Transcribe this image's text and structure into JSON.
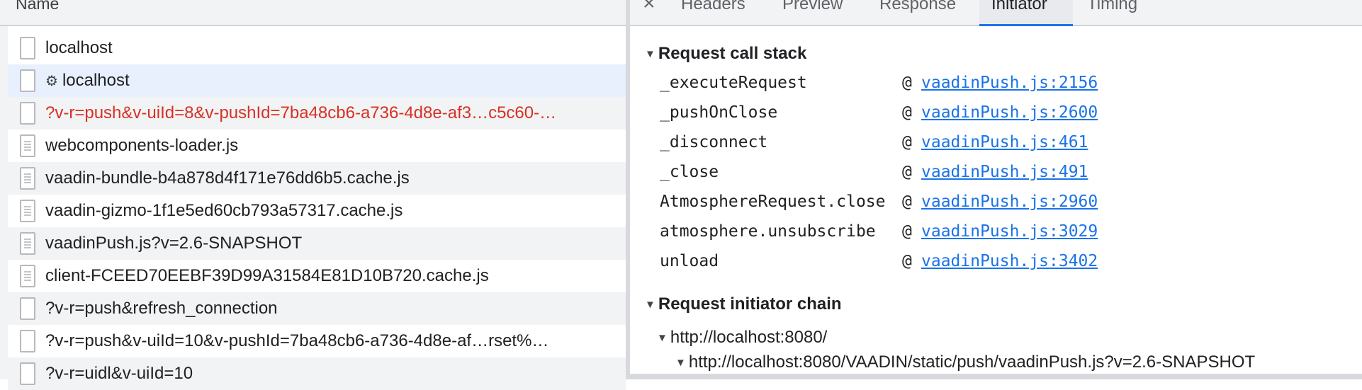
{
  "list": {
    "column_name": "Name",
    "rows": [
      {
        "name": "localhost",
        "icon": "document-icon",
        "gear": ""
      },
      {
        "name": "localhost",
        "icon": "document-icon",
        "gear": "⚙"
      },
      {
        "name": "?v-r=push&v-uiId=8&v-pushId=7ba48cb6-a736-4d8e-af3…c5c60-…",
        "icon": "document-icon",
        "gear": ""
      },
      {
        "name": "webcomponents-loader.js",
        "icon": "script-icon",
        "gear": ""
      },
      {
        "name": "vaadin-bundle-b4a878d4f171e76dd6b5.cache.js",
        "icon": "script-icon",
        "gear": ""
      },
      {
        "name": "vaadin-gizmo-1f1e5ed60cb793a57317.cache.js",
        "icon": "script-icon",
        "gear": ""
      },
      {
        "name": "vaadinPush.js?v=2.6-SNAPSHOT",
        "icon": "script-icon",
        "gear": ""
      },
      {
        "name": "client-FCEED70EEBF39D99A31584E81D10B720.cache.js",
        "icon": "script-icon",
        "gear": ""
      },
      {
        "name": "?v-r=push&refresh_connection",
        "icon": "document-icon",
        "gear": ""
      },
      {
        "name": "?v-r=push&v-uiId=10&v-pushId=7ba48cb6-a736-4d8e-af…rset%…",
        "icon": "document-icon",
        "gear": ""
      },
      {
        "name": "?v-r=uidl&v-uiId=10",
        "icon": "document-icon",
        "gear": ""
      }
    ]
  },
  "tabs": {
    "close": "×",
    "items": [
      "Headers",
      "Preview",
      "Response",
      "Initiator",
      "Timing"
    ],
    "active": "Initiator"
  },
  "call_stack": {
    "toggle": "▼",
    "title": "Request call stack",
    "at": "@",
    "frames": [
      {
        "fn": "_executeRequest",
        "loc": "vaadinPush.js:2156"
      },
      {
        "fn": "_pushOnClose",
        "loc": "vaadinPush.js:2600"
      },
      {
        "fn": "_disconnect",
        "loc": "vaadinPush.js:461"
      },
      {
        "fn": "_close",
        "loc": "vaadinPush.js:491"
      },
      {
        "fn": "AtmosphereRequest.close",
        "loc": "vaadinPush.js:2960"
      },
      {
        "fn": "atmosphere.unsubscribe",
        "loc": "vaadinPush.js:3029"
      },
      {
        "fn": "unload",
        "loc": "vaadinPush.js:3402"
      }
    ]
  },
  "initiator_chain": {
    "toggle": "▼",
    "title": "Request initiator chain",
    "items": [
      "http://localhost:8080/",
      "http://localhost:8080/VAADIN/static/push/vaadinPush.js?v=2.6-SNAPSHOT"
    ]
  },
  "colors": {
    "link": "#1a73e8",
    "failed": "#d93025",
    "selected_row": "#e8f0fe",
    "active_tab_underline": "#1a73e8"
  }
}
